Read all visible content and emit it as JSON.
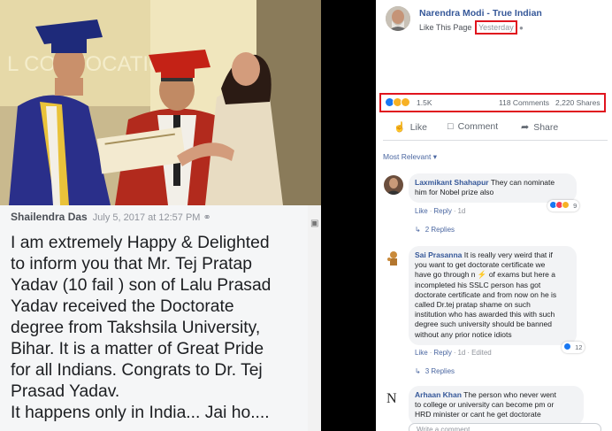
{
  "original_post": {
    "author": "Shailendra Das",
    "timestamp": "July 5, 2017 at 12:57 PM",
    "text_lines": [
      "I am extremely Happy & Delighted",
      "to inform you that Mr. Tej Pratap",
      "Yadav (10 fail ) son of Lalu Prasad",
      "Yadav received the Doctorate",
      "degree from Takshsila University,",
      "Bihar. It is a matter of Great Pride",
      "for all Indians. Congrats to Dr. Tej",
      "Prasad Yadav.",
      "It happens only in India... Jai ho...."
    ],
    "banner_text": "L CONVOCATION"
  },
  "share_post": {
    "page_name": "Narendra Modi - True Indian",
    "like_page_label": "Like This Page",
    "time_label": "Yesterday",
    "reaction_count": "1.5K",
    "comments_count": "118 Comments",
    "shares_count": "2,220 Shares",
    "actions": {
      "like": "Like",
      "comment": "Comment",
      "share": "Share"
    },
    "sort_label": "Most Relevant",
    "write_placeholder": "Write a comment..."
  },
  "comments": [
    {
      "name": "Laxmikant Shahapur",
      "lines": [
        "They can nominate",
        "him for Nobel prize also"
      ],
      "like": "Like",
      "reply": "Reply",
      "time": "1d",
      "reaction_count": "9",
      "replies": "2 Replies"
    },
    {
      "name": "Sai Prasanna",
      "lines": [
        "It is really very weird that if",
        "you want to get doctorate certificate we",
        "have go through n ⚡ of exams but here a",
        "incompleted his SSLC person has got",
        "doctorate certificate and from now on he is",
        "called Dr.tej pratap shame on such",
        "institution who has awarded this with such",
        "degree such university should be banned",
        "without any prior notice idiots"
      ],
      "like": "Like",
      "reply": "Reply",
      "time": "1d",
      "edited": "Edited",
      "reaction_count": "12",
      "replies": "3 Replies"
    },
    {
      "name": "Arhaan Khan",
      "lines": [
        "The person who never went",
        "to college or university can become pm or",
        "HRD minister or cant he get doctorate"
      ]
    }
  ],
  "colors": {
    "highlight": "#e0141e",
    "link": "#365899",
    "like_blue": "#1877f2",
    "love_red": "#f33e58",
    "haha_yellow": "#f7b125"
  },
  "icons": [
    "globe-icon",
    "thumbs-up-icon",
    "comment-icon",
    "share-icon",
    "caret-down-icon",
    "reply-arrow-icon",
    "camera-icon"
  ]
}
